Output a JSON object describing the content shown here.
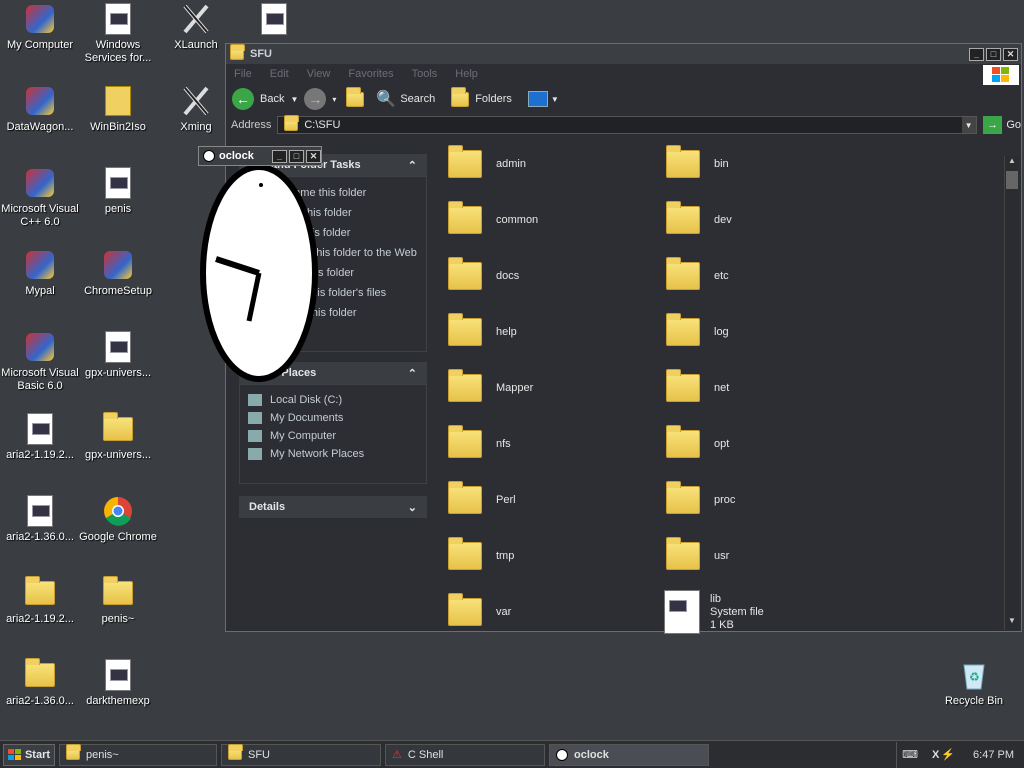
{
  "desktop_icons": [
    {
      "label": "My Computer",
      "icon": "computer-icon"
    },
    {
      "label": "Windows Services for...",
      "icon": "doc-icon"
    },
    {
      "label": "XLaunch",
      "icon": "x-icon"
    },
    {
      "label": "",
      "icon": "doc-icon"
    },
    {
      "label": "DataWagon...",
      "icon": "datawagon-icon"
    },
    {
      "label": "WinBin2Iso",
      "icon": "zip-icon"
    },
    {
      "label": "Xming",
      "icon": "x-icon"
    },
    {
      "label": "Microsoft Visual C++ 6.0",
      "icon": "vc-icon"
    },
    {
      "label": "penis",
      "icon": "doc-icon"
    },
    {
      "label": "Mypal",
      "icon": "mypal-icon"
    },
    {
      "label": "ChromeSetup",
      "icon": "setup-icon"
    },
    {
      "label": "Microsoft Visual Basic 6.0",
      "icon": "vb-icon"
    },
    {
      "label": "gpx-univers...",
      "icon": "doc-icon"
    },
    {
      "label": "aria2-1.19.2...",
      "icon": "doc-icon"
    },
    {
      "label": "gpx-univers...",
      "icon": "folder-icon"
    },
    {
      "label": "aria2-1.36.0...",
      "icon": "doc-icon"
    },
    {
      "label": "Google Chrome",
      "icon": "chrome-icon"
    },
    {
      "label": "aria2-1.19.2...",
      "icon": "folder-icon"
    },
    {
      "label": "penis~",
      "icon": "folder-icon"
    },
    {
      "label": "aria2-1.36.0...",
      "icon": "folder-icon"
    },
    {
      "label": "darkthemexp",
      "icon": "image-icon"
    },
    {
      "label": "Recycle Bin",
      "icon": "recycle-icon"
    }
  ],
  "window": {
    "title": "SFU",
    "menus": [
      "File",
      "Edit",
      "View",
      "Favorites",
      "Tools",
      "Help"
    ],
    "toolbar": {
      "back": "Back",
      "search": "Search",
      "folders": "Folders"
    },
    "address_label": "Address",
    "address_value": "C:\\SFU",
    "go": "Go",
    "tasks_title": "File and Folder Tasks",
    "tasks": [
      "Rename this folder",
      "Move this folder",
      "Copy this folder",
      "Publish this folder to the Web",
      "Share this folder",
      "E-mail this folder's files",
      "Delete this folder"
    ],
    "places_title": "Other Places",
    "places": [
      "Local Disk (C:)",
      "My Documents",
      "My Computer",
      "My Network Places"
    ],
    "details_title": "Details",
    "folders": [
      "admin",
      "bin",
      "common",
      "dev",
      "docs",
      "etc",
      "help",
      "log",
      "Mapper",
      "net",
      "nfs",
      "opt",
      "Perl",
      "proc",
      "tmp",
      "usr",
      "var"
    ],
    "file": {
      "name": "lib",
      "type": "System file",
      "size": "1 KB"
    }
  },
  "oclock": {
    "title": "oclock"
  },
  "taskbar": {
    "start": "Start",
    "tasks": [
      "penis~",
      "SFU",
      "C Shell",
      "oclock"
    ],
    "time": "6:47 PM"
  }
}
